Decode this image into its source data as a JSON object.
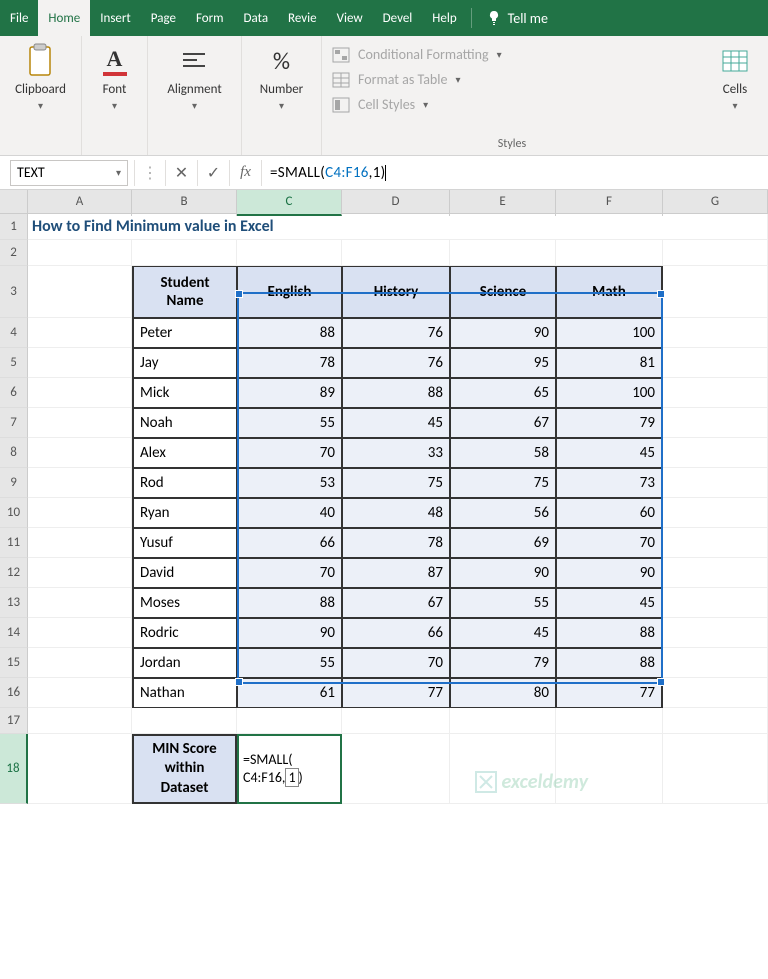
{
  "ribbon": {
    "tabs": [
      "File",
      "Home",
      "Insert",
      "Page",
      "Form",
      "Data",
      "Revie",
      "View",
      "Devel",
      "Help"
    ],
    "active": 1,
    "tellme_label": "Tell me",
    "groups": {
      "clipboard": "Clipboard",
      "font": "Font",
      "alignment": "Alignment",
      "number": "Number",
      "styles": "Styles",
      "cells": "Cells"
    },
    "styles_items": {
      "cond": "Conditional Formatting",
      "table": "Format as Table",
      "cell": "Cell Styles"
    }
  },
  "formula_bar": {
    "namebox": "TEXT",
    "formula_prefix": "=SMALL(",
    "formula_range": "C4:F16",
    "formula_k": ",1",
    "formula_close": ")"
  },
  "columns": [
    "A",
    "B",
    "C",
    "D",
    "E",
    "F",
    "G"
  ],
  "title": "How to Find Minimum value in Excel",
  "table": {
    "headers": [
      "Student Name",
      "English",
      "History",
      "Science",
      "Math"
    ],
    "rows": [
      {
        "name": "Peter",
        "scores": [
          88,
          76,
          90,
          100
        ]
      },
      {
        "name": "Jay",
        "scores": [
          78,
          76,
          95,
          81
        ]
      },
      {
        "name": "Mick",
        "scores": [
          89,
          88,
          65,
          100
        ]
      },
      {
        "name": "Noah",
        "scores": [
          55,
          45,
          67,
          79
        ]
      },
      {
        "name": "Alex",
        "scores": [
          70,
          33,
          58,
          45
        ]
      },
      {
        "name": "Rod",
        "scores": [
          53,
          75,
          75,
          73
        ]
      },
      {
        "name": "Ryan",
        "scores": [
          40,
          48,
          56,
          60
        ]
      },
      {
        "name": "Yusuf",
        "scores": [
          66,
          78,
          69,
          70
        ]
      },
      {
        "name": "David",
        "scores": [
          70,
          87,
          90,
          90
        ]
      },
      {
        "name": "Moses",
        "scores": [
          88,
          67,
          55,
          45
        ]
      },
      {
        "name": "Rodric",
        "scores": [
          90,
          66,
          45,
          88
        ]
      },
      {
        "name": "Jordan",
        "scores": [
          55,
          70,
          79,
          88
        ]
      },
      {
        "name": "Nathan",
        "scores": [
          61,
          77,
          80,
          77
        ]
      }
    ]
  },
  "min_section": {
    "label_line1": "MIN Score",
    "label_line2": "within",
    "label_line3": "Dataset",
    "cell_line1": "=SMALL(",
    "cell_line2": "C4:F16,1)"
  },
  "row_numbers": [
    "1",
    "2",
    "3",
    "4",
    "5",
    "6",
    "7",
    "8",
    "9",
    "10",
    "11",
    "12",
    "13",
    "14",
    "15",
    "16",
    "17",
    "18"
  ],
  "watermark": "exceldemy"
}
